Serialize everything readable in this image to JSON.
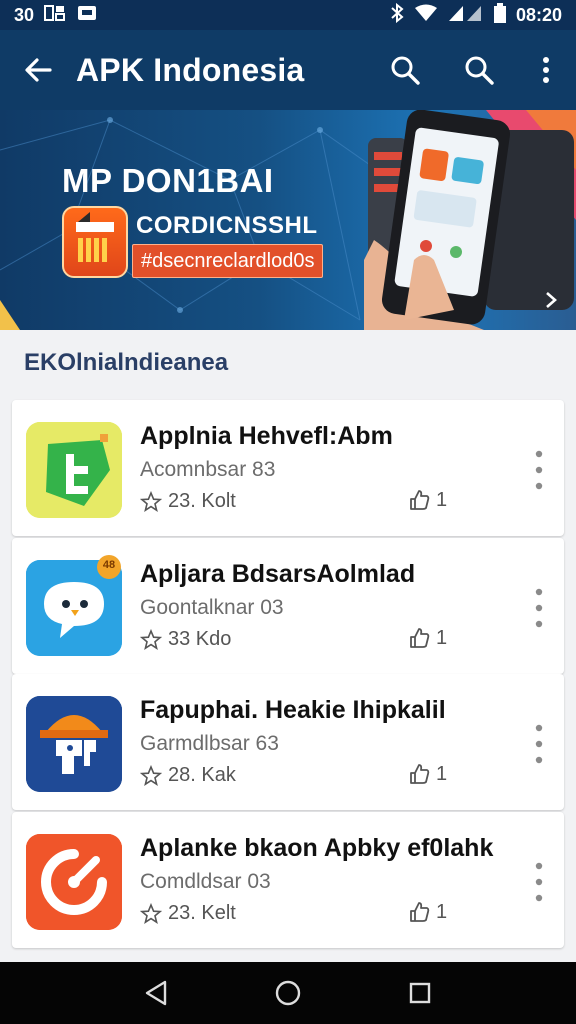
{
  "status_bar": {
    "left_text": "30",
    "left_icons": [
      "notification-icon",
      "mail-icon"
    ],
    "right_icons": [
      "bluetooth-icon",
      "wifi-icon",
      "signal-icon",
      "battery-icon"
    ],
    "time": "08:20"
  },
  "app_bar": {
    "title": "APK Indonesia",
    "icons": [
      "back-arrow-icon",
      "search-icon",
      "search-icon",
      "more-vert-icon"
    ]
  },
  "banner": {
    "heading": "MP DON1BAI",
    "subheading": "CORDICNSSHL",
    "pill_text": "#dsecnreclardlod0s",
    "colors": {
      "accent": "#e2502a",
      "background": "#155083"
    }
  },
  "section": {
    "title": "EKOlnialndieanea"
  },
  "apps": [
    {
      "name": "Applnia Hehvefl:Abm",
      "developer": "Acomnbsar 83",
      "rating": "23. Kolt",
      "likes": "1",
      "icon": "green-tile-icon",
      "icon_color": "#e3e85a"
    },
    {
      "name": "Apljara BdsarsAolmlad",
      "developer": "Goontalknar 03",
      "rating": "33  Kdo",
      "likes": "1",
      "icon": "chat-bubble-icon",
      "icon_color": "#2ba3e3",
      "badge": "48"
    },
    {
      "name": "Fapuphai. Heakie Ihipkalil",
      "developer": "Garmdlbsar 63",
      "rating": "28. Kak",
      "likes": "1",
      "icon": "hard-hat-icon",
      "icon_color": "#1f4a96"
    },
    {
      "name": "Aplanke bkaon Apbky ef0lahk",
      "developer": "Comdldsar 03",
      "rating": "23. Kelt",
      "likes": "1",
      "icon": "circular-arrow-icon",
      "icon_color": "#f0552a"
    }
  ],
  "nav_bar": {
    "icons": [
      "back-triangle-icon",
      "home-circle-icon",
      "recents-square-icon"
    ]
  }
}
